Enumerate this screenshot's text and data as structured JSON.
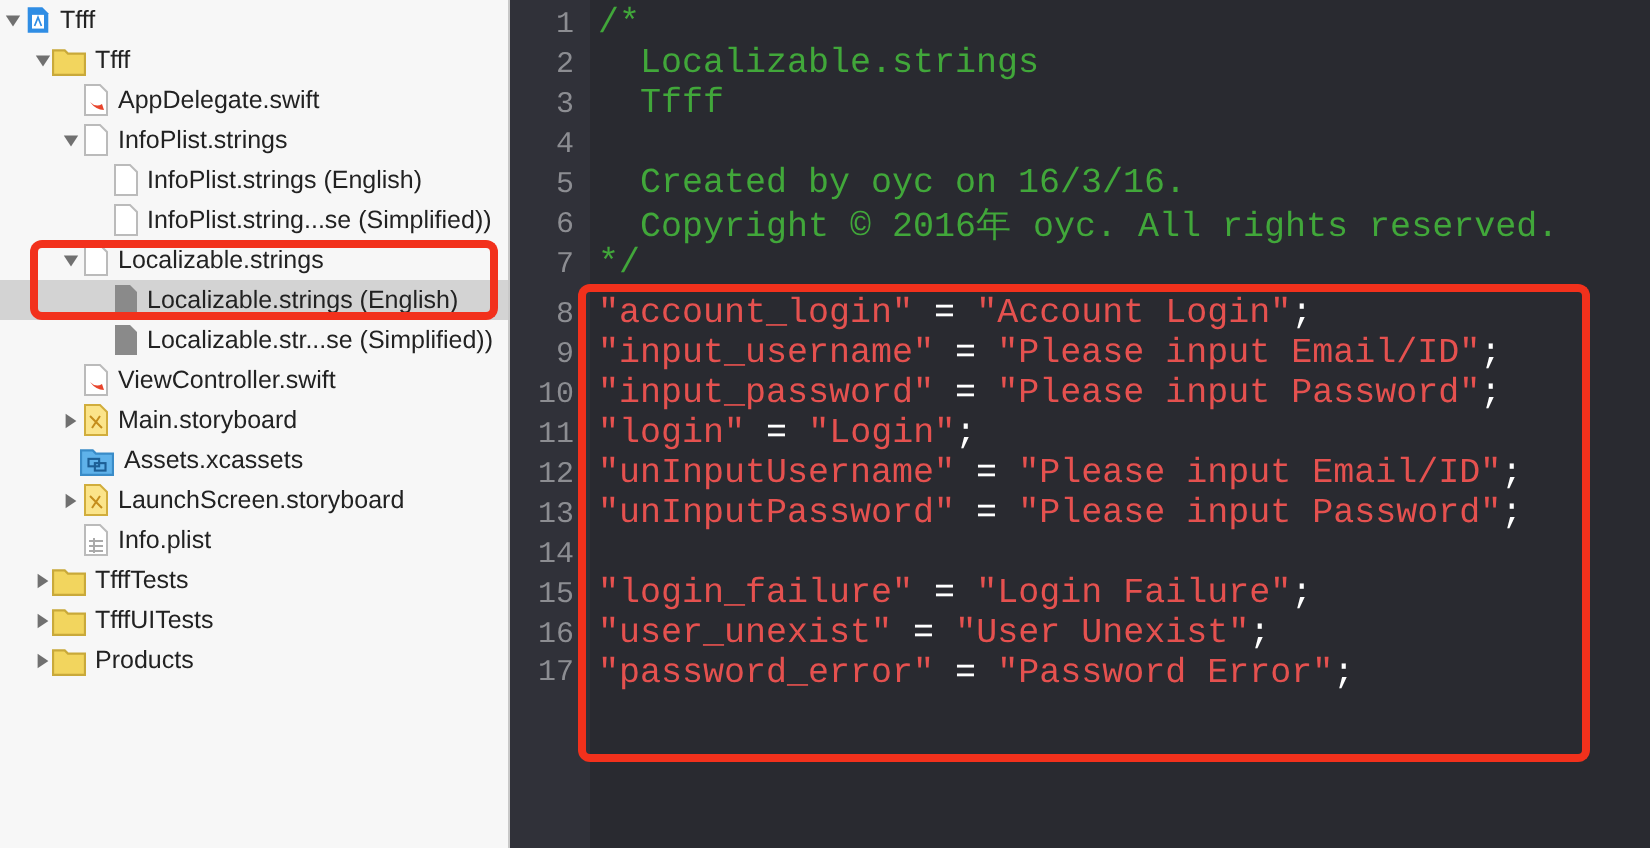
{
  "sidebar": {
    "tree": [
      {
        "name": "Tfff",
        "kind": "project",
        "expanded": true,
        "selected": false,
        "boxed": false,
        "children": [
          {
            "name": "Tfff",
            "kind": "folder",
            "expanded": true,
            "selected": false,
            "boxed": false,
            "children": [
              {
                "name": "AppDelegate.swift",
                "kind": "swift",
                "selected": false,
                "boxed": false
              },
              {
                "name": "InfoPlist.strings",
                "kind": "strings",
                "expanded": true,
                "selected": false,
                "boxed": false,
                "children": [
                  {
                    "name": "InfoPlist.strings (English)",
                    "kind": "strings",
                    "selected": false,
                    "boxed": false
                  },
                  {
                    "name": "InfoPlist.string...se (Simplified))",
                    "kind": "strings",
                    "selected": false,
                    "boxed": false
                  }
                ]
              },
              {
                "name": "Localizable.strings",
                "kind": "strings",
                "expanded": true,
                "selected": false,
                "boxed": true,
                "children": [
                  {
                    "name": "Localizable.strings (English)",
                    "kind": "strings_dim",
                    "selected": true,
                    "boxed": true
                  },
                  {
                    "name": "Localizable.str...se (Simplified))",
                    "kind": "strings_dim",
                    "selected": false,
                    "boxed": false
                  }
                ]
              },
              {
                "name": "ViewController.swift",
                "kind": "swift",
                "selected": false,
                "boxed": false
              },
              {
                "name": "Main.storyboard",
                "kind": "storyboard",
                "expanded": false,
                "selected": false,
                "boxed": false
              },
              {
                "name": "Assets.xcassets",
                "kind": "assets",
                "selected": false,
                "boxed": false
              },
              {
                "name": "LaunchScreen.storyboard",
                "kind": "storyboard",
                "expanded": false,
                "selected": false,
                "boxed": false
              },
              {
                "name": "Info.plist",
                "kind": "plist",
                "selected": false,
                "boxed": false
              }
            ]
          },
          {
            "name": "TfffTests",
            "kind": "folder",
            "expanded": false,
            "selected": false,
            "boxed": false
          },
          {
            "name": "TfffUITests",
            "kind": "folder",
            "expanded": false,
            "selected": false,
            "boxed": false
          },
          {
            "name": "Products",
            "kind": "folder",
            "expanded": false,
            "selected": false,
            "boxed": false
          }
        ]
      }
    ]
  },
  "editor": {
    "lines": [
      {
        "number": "1",
        "kind": "comment",
        "text": "/*",
        "boxed": false
      },
      {
        "number": "2",
        "kind": "comment",
        "text": "  Localizable.strings",
        "boxed": false
      },
      {
        "number": "3",
        "kind": "comment",
        "text": "  Tfff",
        "boxed": false
      },
      {
        "number": "4",
        "kind": "blank",
        "boxed": false
      },
      {
        "number": "5",
        "kind": "comment",
        "text": "  Created by oyc on 16/3/16.",
        "boxed": false
      },
      {
        "number": "6",
        "kind": "comment",
        "text": "  Copyright © 2016年 oyc. All rights reserved.",
        "boxed": false
      },
      {
        "number": "7",
        "kind": "comment",
        "text": "*/",
        "boxed": false
      },
      {
        "number": "8",
        "kind": "pair",
        "key": "\"account_login\"",
        "operator": "=",
        "value": "\"Account Login\"",
        "terminator": ";",
        "boxed": true
      },
      {
        "number": "9",
        "kind": "pair",
        "key": "\"input_username\"",
        "operator": "=",
        "value": "\"Please input Email/ID\"",
        "terminator": ";",
        "boxed": true
      },
      {
        "number": "10",
        "kind": "pair",
        "key": "\"input_password\"",
        "operator": "=",
        "value": "\"Please input Password\"",
        "terminator": ";",
        "boxed": true
      },
      {
        "number": "11",
        "kind": "pair",
        "key": "\"login\"",
        "operator": "=",
        "value": "\"Login\"",
        "terminator": ";",
        "boxed": true
      },
      {
        "number": "12",
        "kind": "pair",
        "key": "\"unInputUsername\"",
        "operator": "=",
        "value": "\"Please input Email/ID\"",
        "terminator": ";",
        "boxed": true
      },
      {
        "number": "13",
        "kind": "pair",
        "key": "\"unInputPassword\"",
        "operator": "=",
        "value": "\"Please input Password\"",
        "terminator": ";",
        "boxed": true
      },
      {
        "number": "14",
        "kind": "blank",
        "boxed": true
      },
      {
        "number": "15",
        "kind": "pair",
        "key": "\"login_failure\"",
        "operator": "=",
        "value": "\"Login Failure\"",
        "terminator": ";",
        "boxed": true
      },
      {
        "number": "16",
        "kind": "pair",
        "key": "\"user_unexist\"",
        "operator": "=",
        "value": "\"User Unexist\"",
        "terminator": ";",
        "boxed": true
      },
      {
        "number": "17",
        "kind": "pair",
        "key": "\"password_error\"",
        "operator": "=",
        "value": "\"Password Error\"",
        "terminator": ";",
        "boxed": true
      }
    ]
  }
}
